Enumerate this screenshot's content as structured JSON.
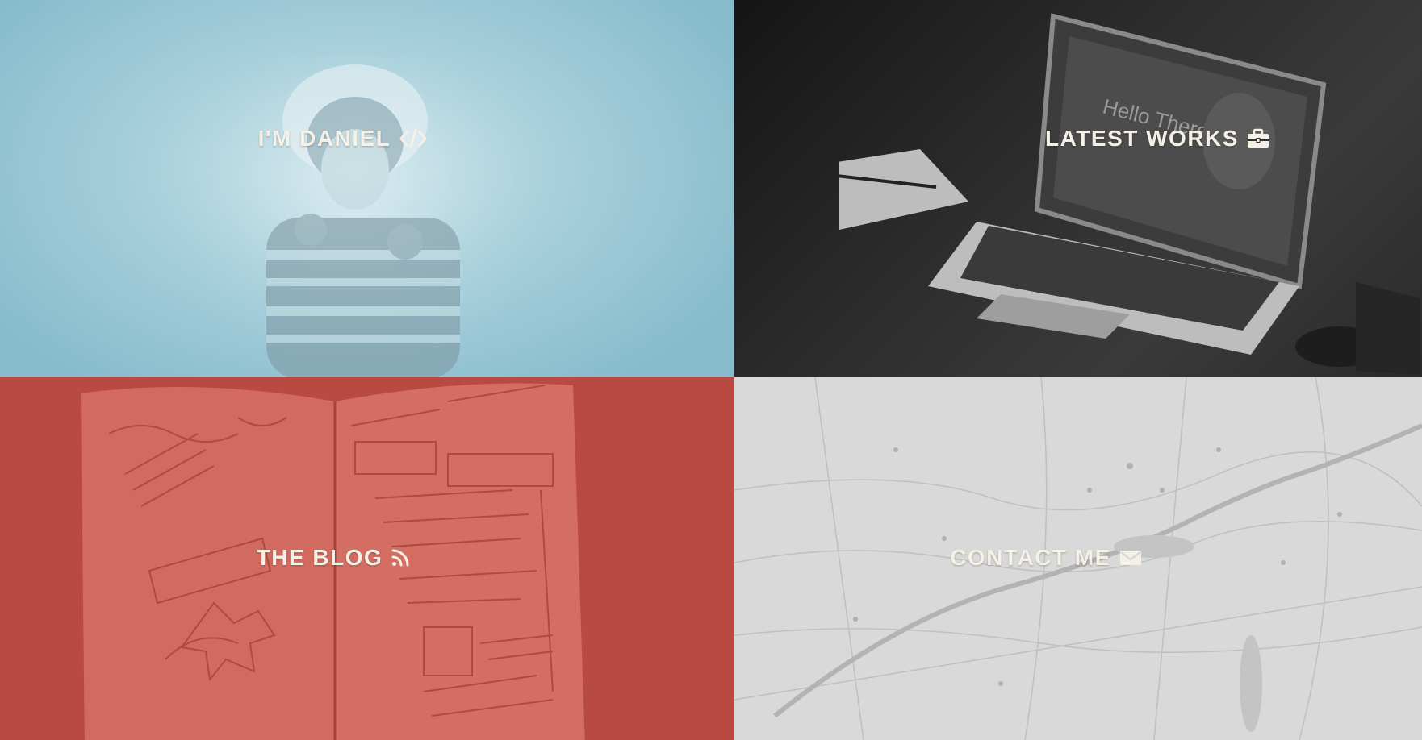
{
  "tiles": [
    {
      "label": "I'M DANIEL",
      "icon": "code-icon",
      "color": "#86bccc"
    },
    {
      "label": "LATEST WORKS",
      "icon": "briefcase-icon",
      "color": "#2a2a2a"
    },
    {
      "label": "THE BLOG",
      "icon": "rss-icon",
      "color": "#b94a42"
    },
    {
      "label": "CONTACT ME",
      "icon": "envelope-icon",
      "color": "#d9d9d9"
    }
  ],
  "laptop_screen": {
    "headline": "Hello There!"
  }
}
